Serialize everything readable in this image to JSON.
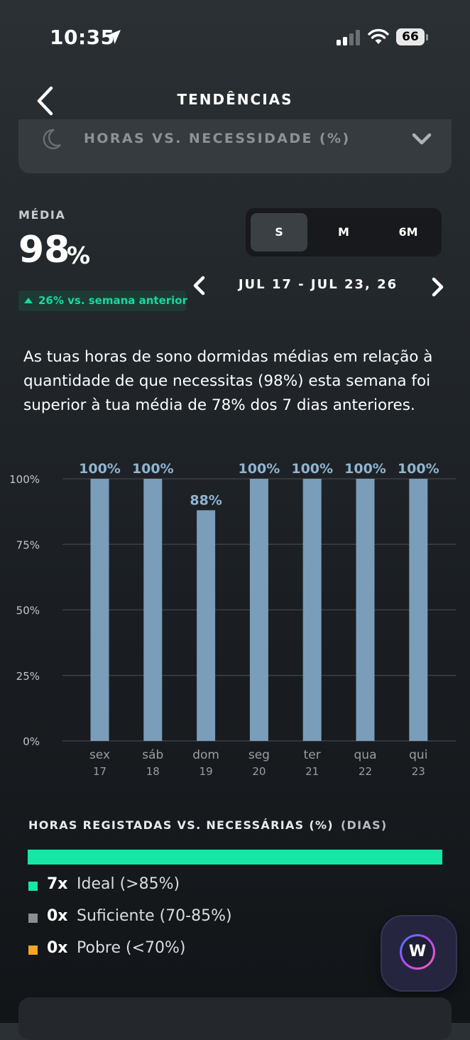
{
  "status_bar": {
    "time": "10:35",
    "battery": "66"
  },
  "header": {
    "title": "TENDÊNCIAS"
  },
  "metric_select": {
    "label": "HORAS VS. NECESSIDADE (%)"
  },
  "media": {
    "label": "MÉDIA",
    "value": "98",
    "unit": "%",
    "change": "26% vs. semana anterior"
  },
  "period": {
    "options": [
      "S",
      "M",
      "6M"
    ],
    "selected": "S"
  },
  "date_nav": {
    "range": "JUL 17 - JUL 23, 26"
  },
  "description": "As tuas horas de sono dormidas médias em relação à quantidade de que necessitas (98%) esta semana foi superior à tua média de 78% dos 7 dias anteriores.",
  "chart_data": {
    "type": "bar",
    "categories": [
      "sex",
      "sáb",
      "dom",
      "seg",
      "ter",
      "qua",
      "qui"
    ],
    "day_numbers": [
      "17",
      "18",
      "19",
      "20",
      "21",
      "22",
      "23"
    ],
    "values": [
      100,
      100,
      88,
      100,
      100,
      100,
      100
    ],
    "data_labels": [
      "100%",
      "100%",
      "88%",
      "100%",
      "100%",
      "100%",
      "100%"
    ],
    "yticks": [
      "100%",
      "75%",
      "50%",
      "25%",
      "0%"
    ],
    "ylim": [
      0,
      100
    ],
    "grid": true,
    "bar_color": "#7a9db9"
  },
  "legend": {
    "title": "HORAS REGISTADAS VS. NECESSÁRIAS (%)",
    "subtitle": "(DIAS)",
    "items": [
      {
        "count": "7x",
        "label": "Ideal (>85%)",
        "color": "#16e6a6"
      },
      {
        "count": "0x",
        "label": "Suficiente (70-85%)",
        "color": "#8b8e92"
      },
      {
        "count": "0x",
        "label": "Pobre (<70%)",
        "color": "#f5a623"
      }
    ]
  },
  "assistant": {
    "letter": "W"
  }
}
